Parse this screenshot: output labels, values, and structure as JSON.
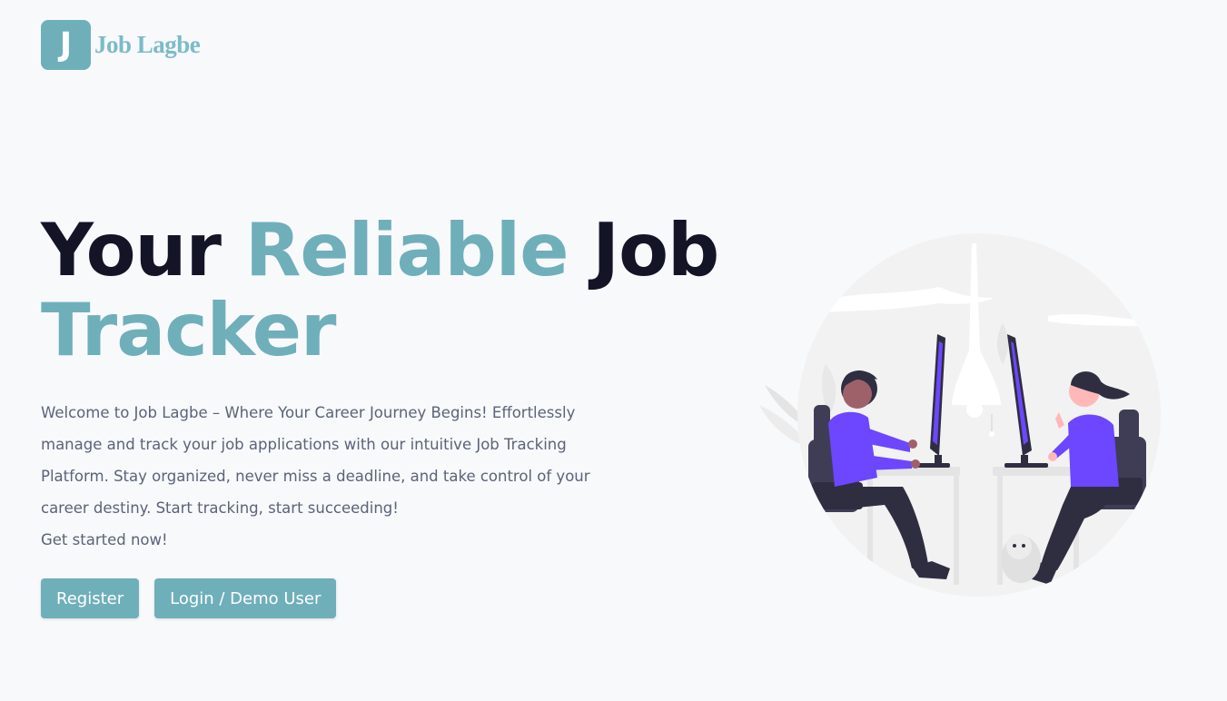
{
  "logo": {
    "mark": "J",
    "name": "Job Lagbe"
  },
  "hero": {
    "headline_part1": "Your ",
    "headline_accent1": "Reliable",
    "headline_part2": " Job ",
    "headline_accent2": "Tracker",
    "description": "Welcome to Job Lagbe – Where Your Career Journey Begins! Effortlessly manage and track your job applications with our intuitive Job Tracking Platform. Stay organized, never miss a deadline, and take control of your career destiny. Start tracking, start succeeding!",
    "cta_text": "Get started now!"
  },
  "buttons": {
    "register": "Register",
    "login": "Login / Demo User"
  },
  "colors": {
    "accent": "#6fafba",
    "heading": "#141427",
    "body_text": "#5a6478",
    "illustration_primary": "#6c47ff"
  }
}
